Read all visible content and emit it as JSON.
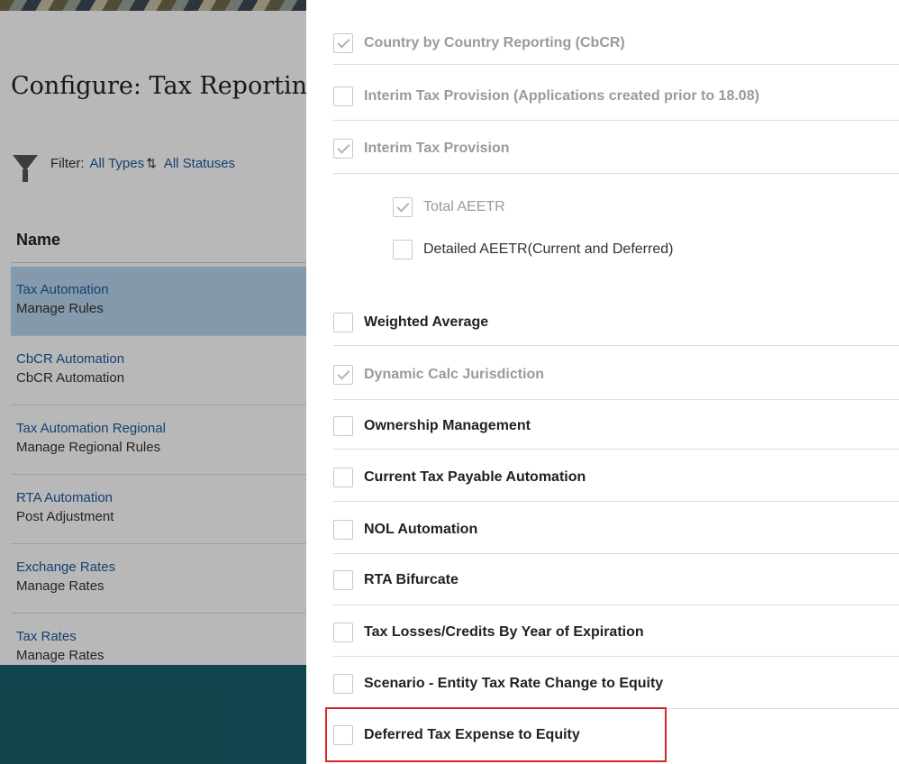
{
  "page": {
    "title": "Configure: Tax Reporting"
  },
  "filter": {
    "label": "Filter:",
    "types": "All Types",
    "statuses": "All Statuses"
  },
  "table": {
    "column_header": "Name",
    "rows": [
      {
        "name": "Tax Automation",
        "description": "Manage Rules"
      },
      {
        "name": "CbCR Automation",
        "description": "CbCR Automation"
      },
      {
        "name": "Tax Automation Regional",
        "description": "Manage Regional Rules"
      },
      {
        "name": "RTA Automation",
        "description": "Post Adjustment"
      },
      {
        "name": "Exchange Rates",
        "description": "Manage Rates"
      },
      {
        "name": "Tax Rates",
        "description": "Manage Rates"
      }
    ]
  },
  "options": [
    {
      "label": "Country by Country Reporting (CbCR)",
      "checked": true,
      "enabled": false
    },
    {
      "label": "Interim Tax Provision (Applications created prior to 18.08)",
      "checked": false,
      "enabled": false
    },
    {
      "label": "Interim Tax Provision",
      "checked": true,
      "enabled": false
    },
    {
      "label": "Total AEETR",
      "checked": true,
      "enabled": false
    },
    {
      "label": "Detailed AEETR(Current and Deferred)",
      "checked": false,
      "enabled": true
    },
    {
      "label": "Weighted Average",
      "checked": false,
      "enabled": true
    },
    {
      "label": "Dynamic Calc Jurisdiction",
      "checked": true,
      "enabled": false
    },
    {
      "label": "Ownership Management",
      "checked": false,
      "enabled": true
    },
    {
      "label": "Current Tax Payable Automation",
      "checked": false,
      "enabled": true
    },
    {
      "label": "NOL Automation",
      "checked": false,
      "enabled": true
    },
    {
      "label": "RTA Bifurcate",
      "checked": false,
      "enabled": true
    },
    {
      "label": "Tax Losses/Credits By Year of Expiration",
      "checked": false,
      "enabled": true
    },
    {
      "label": "Scenario - Entity Tax Rate Change to Equity",
      "checked": false,
      "enabled": true
    },
    {
      "label": "Deferred Tax Expense to Equity",
      "checked": false,
      "enabled": true,
      "highlighted": true
    }
  ],
  "colors": {
    "highlight": "#d9262c",
    "link": "#1b5a9a",
    "selected_row": "#b8d4ee",
    "footer": "#175f6c"
  }
}
